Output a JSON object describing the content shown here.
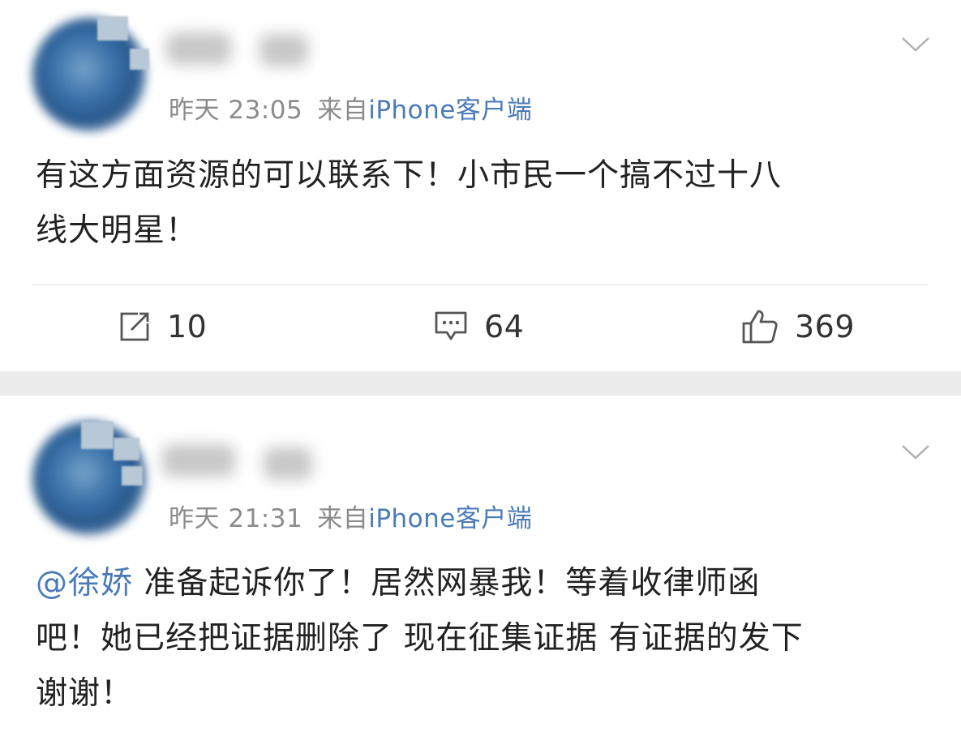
{
  "posts": [
    {
      "timestamp": "昨天 23:05",
      "source_prefix": "来自",
      "source": "iPhone客户端",
      "text_line1": "有这方面资源的可以联系下！小市民一个搞不过十八",
      "text_line2": "线大明星！",
      "actions": {
        "repost_count": "10",
        "comment_count": "64",
        "like_count": "369"
      }
    },
    {
      "timestamp": "昨天 21:31",
      "source_prefix": "来自",
      "source": "iPhone客户端",
      "mention": "@徐娇",
      "text_line1_rest": " 准备起诉你了！居然网暴我！等着收律师函",
      "text_line2": "吧！她已经把证据删除了 现在征集证据 有证据的发下",
      "text_line3": "谢谢！"
    }
  ],
  "icons": {
    "repost": "repost-icon",
    "comment": "comment-icon",
    "like": "thumbs-up-icon",
    "menu": "chevron-down-icon"
  },
  "colors": {
    "link": "#4a7ab8",
    "meta": "#8b8b8b",
    "text": "#222222",
    "separator": "#ececec"
  }
}
